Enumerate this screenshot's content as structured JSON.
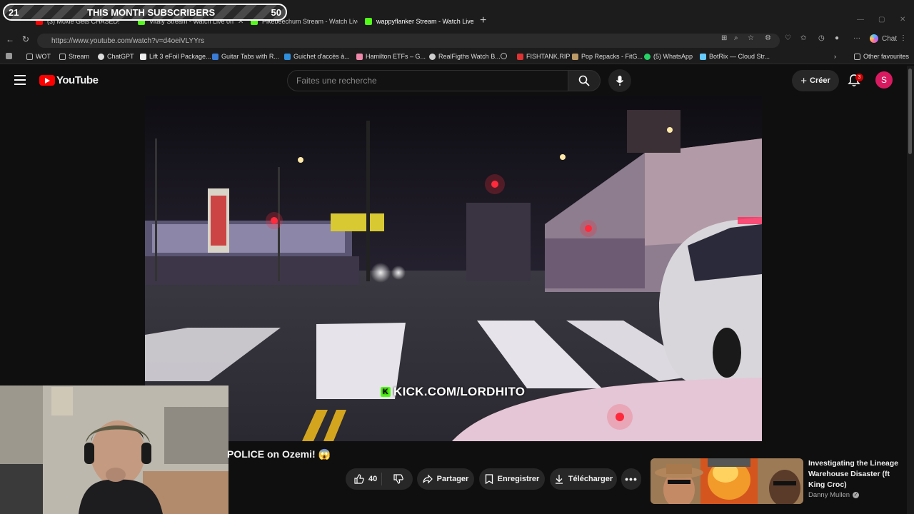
{
  "overlay": {
    "left": "21",
    "title": "THIS MONTH SUBSCRIBERS",
    "right": "50"
  },
  "tabs": [
    {
      "title": "(3) Moxie Gets CHASED!"
    },
    {
      "title": "Vitaly Stream - Watch Live on"
    },
    {
      "title": "Pikebeechum Stream - Watch Live"
    },
    {
      "title": "wappyflanker Stream - Watch Live"
    }
  ],
  "address": {
    "url": "https://www.youtube.com/watch?v=d4oeiVLYYrs"
  },
  "browser": {
    "chat_label": "Chat"
  },
  "bookmarks": [
    {
      "label": "WOT"
    },
    {
      "label": "Stream"
    },
    {
      "label": "ChatGPT"
    },
    {
      "label": "Lift 3 eFoil Package..."
    },
    {
      "label": "Guitar Tabs with R..."
    },
    {
      "label": "Guichet d'accès à..."
    },
    {
      "label": "Hamilton ETFs – G..."
    },
    {
      "label": "RealFigths Watch B..."
    },
    {
      "label": "FISHTANK.RIP"
    },
    {
      "label": "Pop Repacks - FitG..."
    },
    {
      "label": "(5) WhatsApp"
    },
    {
      "label": "BotRix — Cloud Str..."
    },
    {
      "label": "Other favourites"
    }
  ],
  "youtube": {
    "logo_text": "YouTube",
    "search_placeholder": "Faites une recherche",
    "create_label": "Créer",
    "notification_count": "3",
    "avatar_letter": "S"
  },
  "video": {
    "watermark": "KICK.COM/LORDHITO",
    "watermark_badge": "K",
    "title": "POLICE on Ozemi! 😱",
    "likes": "40",
    "share_label": "Partager",
    "save_label": "Enregistrer",
    "download_label": "Télécharger"
  },
  "recommendation": {
    "title": "Investigating the Lineage Warehouse Disaster (ft King Croc)",
    "channel": "Danny Mullen"
  },
  "colors": {
    "kick_green": "#53fc18",
    "yt_red": "#ff0000",
    "avatar": "#d81b60"
  }
}
